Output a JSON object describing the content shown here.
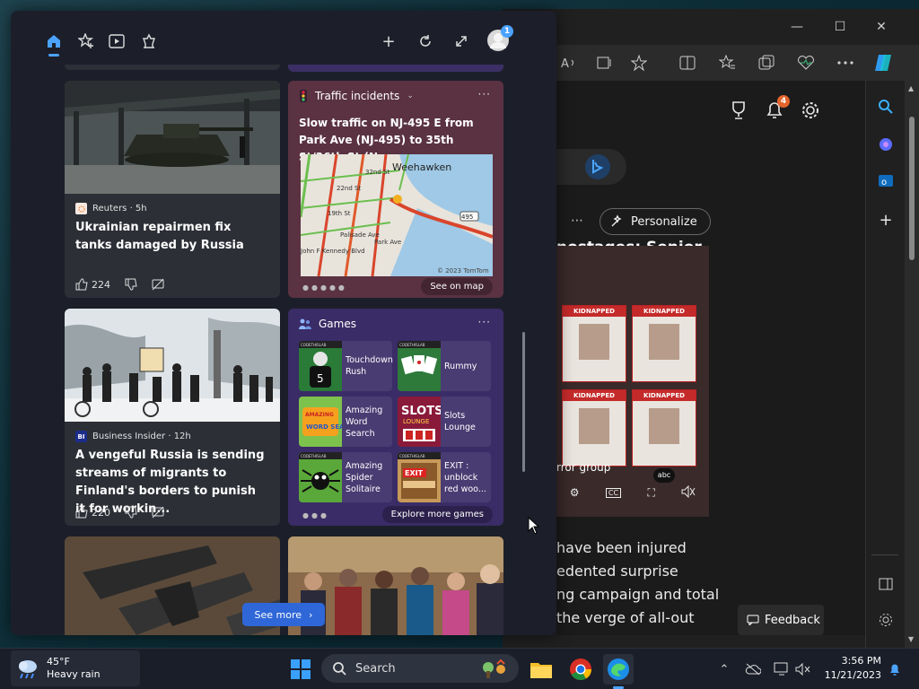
{
  "edge": {
    "window_controls": [
      "—",
      "☐",
      "✕"
    ],
    "article": {
      "headline_partial": "nostages: Senior",
      "personalize_label": "Personalize",
      "video_caption": "rror group",
      "text_lines": [
        "have been injured",
        "edented surprise",
        "ng campaign and total",
        "the verge of all-out"
      ],
      "notification_count": "4",
      "kidnapped_label": "KIDNAPPED",
      "video_logo": "abc"
    },
    "feedback_label": "Feedback"
  },
  "widgets": {
    "header_user_badge": "1",
    "cards": {
      "news1": {
        "source": "Reuters · 5h",
        "headline": "Ukrainian repairmen fix tanks damaged by Russia",
        "likes": "224"
      },
      "traffic": {
        "title": "Traffic incidents",
        "headline": "Slow traffic on NJ-495 E from Park Ave (NJ-495) to 35th St/36th St (N...",
        "map_place": "Weehawken",
        "map_streets": [
          "22nd St",
          "32nd St",
          "19th St",
          "Palisade Ave",
          "Park Ave",
          "John F Kennedy Blvd"
        ],
        "map_route": "495",
        "map_credit": "© 2023 TomTom",
        "see_on_map": "See on map"
      },
      "news2": {
        "source": "Business Insider · 12h",
        "source_logo": "BI",
        "headline": "A vengeful Russia is sending streams of migrants to Finland's borders to punish it for workin...",
        "likes": "220"
      },
      "games": {
        "title": "Games",
        "items": [
          {
            "name": "Touchdown Rush"
          },
          {
            "name": "Rummy"
          },
          {
            "name": "Amazing Word Search"
          },
          {
            "name": "Slots Lounge"
          },
          {
            "name": "Amazing Spider Solitaire"
          },
          {
            "name": "EXIT : unblock red woo..."
          }
        ],
        "explore": "Explore more games",
        "thumb_labels": {
          "publisher": "CODETHISLAB",
          "word": "AMAZING",
          "word_search": "WORD SEARCH",
          "slots": "SLOTS",
          "lounge": "LOUNGE",
          "exit": "EXIT",
          "jersey_number": "5"
        }
      }
    },
    "see_more": "See more"
  },
  "taskbar": {
    "weather_temp": "45°F",
    "weather_desc": "Heavy rain",
    "search_label": "Search",
    "clock_time": "3:56 PM",
    "clock_date": "11/21/2023"
  },
  "colors": {
    "see_more_blue": "#2f67d8",
    "traffic_bg": "#5a3242",
    "games_bg": "#3a2c66",
    "badge_orange": "#e3642b"
  }
}
